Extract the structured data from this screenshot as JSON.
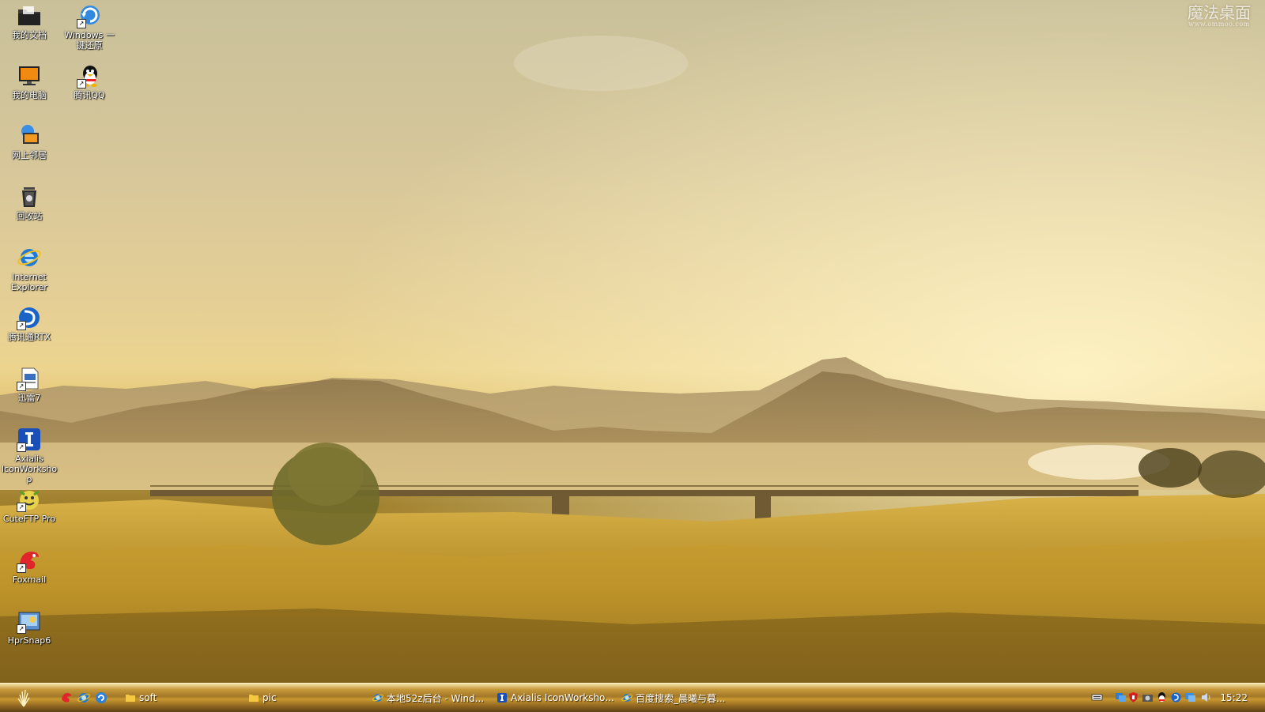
{
  "wallpaper": {
    "watermark_main": "魔法桌面",
    "watermark_sub": "www.ommoo.com"
  },
  "desktop_icons": [
    {
      "label": "我的文档",
      "icon": "folder-icon"
    },
    {
      "label": "我的电脑",
      "icon": "computer-icon"
    },
    {
      "label": "网上邻居",
      "icon": "network-icon"
    },
    {
      "label": "回收站",
      "icon": "recycle-bin-icon"
    },
    {
      "label": "Internet Explorer",
      "icon": "internet-explorer-icon"
    },
    {
      "label": "腾讯通RTX",
      "icon": "rtx-icon"
    },
    {
      "label": "迅雷7",
      "icon": "thunder-icon"
    },
    {
      "label": "Axialis IconWorkshop",
      "icon": "axialis-icon"
    },
    {
      "label": "CuteFTP Pro",
      "icon": "cuteftp-icon"
    },
    {
      "label": "Foxmail",
      "icon": "foxmail-icon"
    },
    {
      "label": "HprSnap6",
      "icon": "hprsnap-icon"
    },
    {
      "label": "Windows 一键还原",
      "icon": "windows-restore-icon"
    },
    {
      "label": "腾讯QQ",
      "icon": "qq-icon"
    }
  ],
  "taskbar": {
    "quick_launch": [
      "foxmail-icon",
      "internet-explorer-icon",
      "browser-icon"
    ],
    "tasks": [
      {
        "label": "soft",
        "icon": "folder-icon"
      },
      {
        "label": "pic",
        "icon": "folder-icon"
      },
      {
        "label": "本地52z后台 - Wind...",
        "icon": "internet-explorer-icon"
      },
      {
        "label": "Axialis IconWorksho...",
        "icon": "axialis-icon"
      },
      {
        "label": "百度搜索_晨曦与暮...",
        "icon": "internet-explorer-icon"
      }
    ],
    "tray_icons": [
      "keyboard-icon",
      "network-tray-icon",
      "security-icon",
      "camera-icon",
      "qq-tray-icon",
      "rtx-tray-icon",
      "monitor-icon",
      "volume-icon"
    ],
    "clock": "15:22"
  }
}
